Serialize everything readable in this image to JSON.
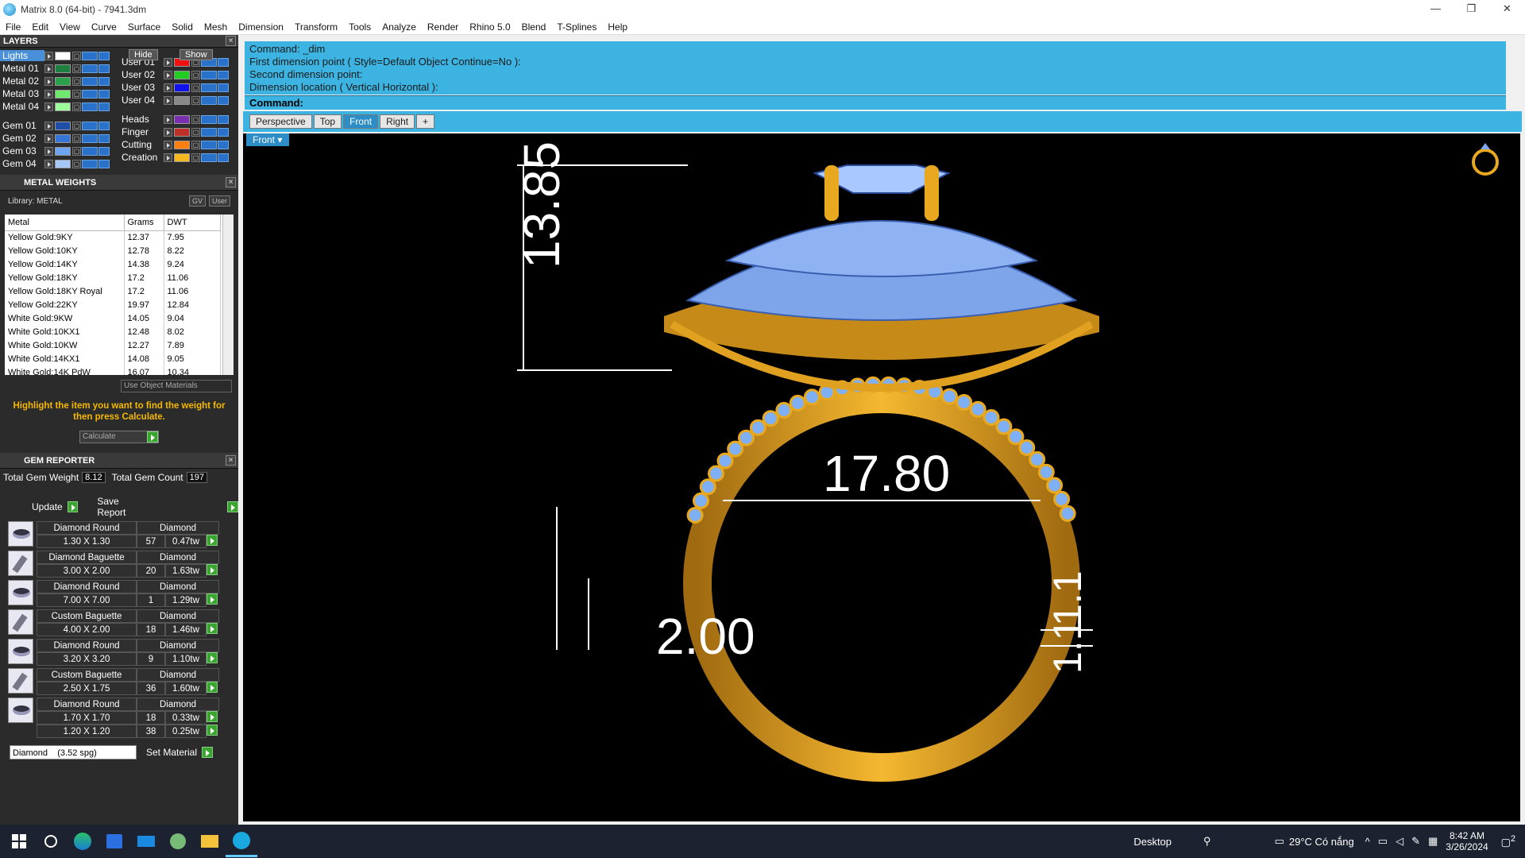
{
  "window": {
    "title": "Matrix 8.0 (64-bit) - 7941.3dm",
    "controls": [
      "—",
      "❐",
      "✕"
    ]
  },
  "menu": [
    "File",
    "Edit",
    "View",
    "Curve",
    "Surface",
    "Solid",
    "Mesh",
    "Dimension",
    "Transform",
    "Tools",
    "Analyze",
    "Render",
    "Rhino 5.0",
    "Blend",
    "T-Splines",
    "Help"
  ],
  "layers": {
    "title": "LAYERS",
    "hide": "Hide",
    "show": "Show",
    "left": [
      {
        "name": "Lights",
        "color": "#ffffff"
      },
      {
        "name": "Metal 01",
        "color": "#1f7f3f"
      },
      {
        "name": "Metal 02",
        "color": "#2aa04a"
      },
      {
        "name": "Metal 03",
        "color": "#6ee86e"
      },
      {
        "name": "Metal 04",
        "color": "#9dfb9d"
      },
      {
        "name": "",
        "color": ""
      },
      {
        "name": "Gem 01",
        "color": "#1f4fa8"
      },
      {
        "name": "Gem 02",
        "color": "#3575d8"
      },
      {
        "name": "Gem 03",
        "color": "#6da4f2"
      },
      {
        "name": "Gem 04",
        "color": "#a6c8f6"
      }
    ],
    "right": [
      {
        "name": "",
        "color": ""
      },
      {
        "name": "User 01",
        "color": "#ee1111"
      },
      {
        "name": "User 02",
        "color": "#22cc22"
      },
      {
        "name": "User 03",
        "color": "#1111ee"
      },
      {
        "name": "User 04",
        "color": "#888888"
      },
      {
        "name": "",
        "color": ""
      },
      {
        "name": "Heads",
        "color": "#7a2fb0"
      },
      {
        "name": "Finger",
        "color": "#c0302a"
      },
      {
        "name": "Cutting",
        "color": "#ff7f10"
      },
      {
        "name": "Creation",
        "color": "#f5b820"
      }
    ]
  },
  "metal_weights": {
    "title": "METAL WEIGHTS",
    "library": "Library: METAL",
    "gv": "GV",
    "user": "User",
    "headers": [
      "Metal",
      "Grams",
      "DWT"
    ],
    "rows": [
      [
        "Yellow Gold:9KY",
        "12.37",
        "7.95"
      ],
      [
        "Yellow Gold:10KY",
        "12.78",
        "8.22"
      ],
      [
        "Yellow Gold:14KY",
        "14.38",
        "9.24"
      ],
      [
        "Yellow Gold:18KY",
        "17.2",
        "11.06"
      ],
      [
        "Yellow Gold:18KY Royal",
        "17.2",
        "11.06"
      ],
      [
        "Yellow Gold:22KY",
        "19.97",
        "12.84"
      ],
      [
        "White Gold:9KW",
        "14.05",
        "9.04"
      ],
      [
        "White Gold:10KX1",
        "12.48",
        "8.02"
      ],
      [
        "White Gold:10KW",
        "12.27",
        "7.89"
      ],
      [
        "White Gold:14KX1",
        "14.08",
        "9.05"
      ],
      [
        "White Gold:14K PdW",
        "16.07",
        "10.34"
      ]
    ],
    "use_object": "Use Object Materials",
    "note": "Highlight the item you want to find the weight for then press Calculate.",
    "calculate": "Calculate"
  },
  "gem_reporter": {
    "title": "GEM REPORTER",
    "weight_label": "Total Gem Weight",
    "weight": "8.12",
    "count_label": "Total Gem Count",
    "count": "197",
    "update": "Update",
    "save": "Save Report",
    "gems": [
      {
        "shape": "round",
        "name": "Diamond Round",
        "size": "1.30 X 1.30",
        "type": "Diamond",
        "qty": "57",
        "tw": "0.47tw"
      },
      {
        "shape": "bag",
        "name": "Diamond Baguette",
        "size": "3.00 X 2.00",
        "type": "Diamond",
        "qty": "20",
        "tw": "1.63tw"
      },
      {
        "shape": "round",
        "name": "Diamond Round",
        "size": "7.00 X 7.00",
        "type": "Diamond",
        "qty": "1",
        "tw": "1.29tw"
      },
      {
        "shape": "bag",
        "name": "Custom Baguette",
        "size": "4.00 X 2.00",
        "type": "Diamond",
        "qty": "18",
        "tw": "1.46tw"
      },
      {
        "shape": "round",
        "name": "Diamond Round",
        "size": "3.20 X 3.20",
        "type": "Diamond",
        "qty": "9",
        "tw": "1.10tw"
      },
      {
        "shape": "bag",
        "name": "Custom Baguette",
        "size": "2.50 X 1.75",
        "type": "Diamond",
        "qty": "36",
        "tw": "1.60tw"
      },
      {
        "shape": "round",
        "name": "Diamond Round",
        "size": "1.70 X 1.70",
        "type": "Diamond",
        "qty": "18",
        "tw": "0.33tw",
        "extra": {
          "size": "1.20 X 1.20",
          "qty": "38",
          "tw": "0.25tw"
        }
      }
    ],
    "material": "Diamond    (3.52 spg)",
    "set_material": "Set Material"
  },
  "command": {
    "history": [
      "Command: _dim",
      "First dimension point ( Style=Default  Object  Continue=No ):",
      "Second dimension point:",
      "Dimension location ( Vertical  Horizontal ):"
    ],
    "prompt": "Command:"
  },
  "viewtabs": [
    "Perspective",
    "Top",
    "Front",
    "Right"
  ],
  "active_tab": "Front",
  "viewport_label": "Front",
  "dims": {
    "height": "13.85",
    "inner": "17.80",
    "band": "2.00",
    "thick": "1.1",
    "thick2": "1.1"
  },
  "taskbar": {
    "desktop": "Desktop",
    "weather": "29°C  Có nắng",
    "time": "8:42 AM",
    "date": "3/26/2024",
    "notif": "2"
  }
}
